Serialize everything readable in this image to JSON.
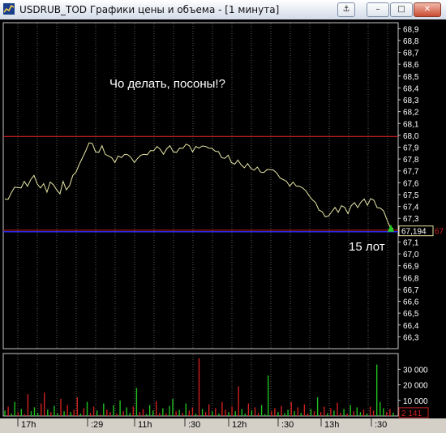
{
  "window": {
    "title": "USDRUB_TOD Графики цены и объема - [1 минута]",
    "buttons": {
      "anchor": "⚓",
      "minimize": "–",
      "maximize": "□",
      "close": "✕"
    }
  },
  "annotations": {
    "question": "Чо делать, посоны!?",
    "lots": "15 лот"
  },
  "price_axis": {
    "labels": [
      "68,9",
      "68,8",
      "68,7",
      "68,6",
      "68,5",
      "68,4",
      "68,3",
      "68,2",
      "68,1",
      "68,0",
      "67,9",
      "67,8",
      "67,7",
      "67,6",
      "67,5",
      "67,4",
      "67,3",
      "67,2",
      "67,1",
      "67,0",
      "66,9",
      "66,8",
      "66,7",
      "66,6",
      "66,5",
      "66,4",
      "66,3"
    ],
    "current_price": "67,194",
    "current_price_cut": "67"
  },
  "volume_axis": {
    "labels": [
      "30 000",
      "20 000",
      "10 000"
    ],
    "current_volume": "2 141"
  },
  "time_axis": {
    "labels": [
      "17h",
      ":29",
      "11h",
      ":30",
      "12h",
      ":30",
      "13h",
      ":30"
    ]
  },
  "colors": {
    "background": "#000000",
    "price_line": "#e8e6a8",
    "resistance": "#cc2020",
    "support": "#3030ff",
    "volume_up": "#20c020",
    "volume_down": "#d02020",
    "marker": "#20d020"
  },
  "chart_data": {
    "type": "line",
    "title": "USDRUB_TOD",
    "ylim": [
      66.2,
      68.95
    ],
    "levels": {
      "resistance": 67.99,
      "support": 67.2,
      "current": 67.194
    },
    "series": [
      {
        "values": [
          67.45,
          67.47,
          67.51,
          67.55,
          67.57,
          67.55,
          67.6,
          67.58,
          67.62,
          67.65,
          67.6,
          67.55,
          67.58,
          67.53,
          67.6,
          67.57,
          67.55,
          67.5,
          67.6,
          67.55,
          67.57,
          67.65,
          67.7,
          67.75,
          67.8,
          67.88,
          67.93,
          67.92,
          67.87,
          67.85,
          67.9,
          67.85,
          67.82,
          67.8,
          67.78,
          67.82,
          67.8,
          67.85,
          67.83,
          67.8,
          67.78,
          67.8,
          67.82,
          67.85,
          67.83,
          67.86,
          67.88,
          67.9,
          67.87,
          67.85,
          67.88,
          67.9,
          67.87,
          67.85,
          67.88,
          67.9,
          67.92,
          67.9,
          67.87,
          67.9,
          67.88,
          67.92,
          67.9,
          67.88,
          67.9,
          67.86,
          67.85,
          67.82,
          67.8,
          67.82,
          67.78,
          67.75,
          67.78,
          67.76,
          67.72,
          67.75,
          67.73,
          67.7,
          67.72,
          67.7,
          67.68,
          67.7,
          67.72,
          67.7,
          67.67,
          67.65,
          67.62,
          67.6,
          67.58,
          67.6,
          67.56,
          67.58,
          67.55,
          67.52,
          67.5,
          67.45,
          67.42,
          67.38,
          67.35,
          67.3,
          67.33,
          67.35,
          67.38,
          67.36,
          67.4,
          67.38,
          67.35,
          67.4,
          67.42,
          67.4,
          67.43,
          67.45,
          67.42,
          67.46,
          67.44,
          67.4,
          67.38,
          67.35,
          67.3,
          67.22,
          67.2
        ]
      }
    ],
    "volume": [
      3500,
      6000,
      1500,
      9000,
      2500,
      4500,
      1200,
      14000,
      3000,
      5500,
      2000,
      8000,
      15000,
      4000,
      2500,
      6500,
      1800,
      11000,
      3000,
      7000,
      2500,
      4000,
      12000,
      1500,
      5000,
      9000,
      2000,
      6000,
      3500,
      1000,
      8000,
      4000,
      2500,
      7000,
      1500,
      10000,
      3000,
      5500,
      2000,
      6000,
      18000,
      2500,
      4500,
      1200,
      7000,
      3500,
      9500,
      2000,
      5000,
      1500,
      6500,
      11000,
      3000,
      4000,
      2000,
      8000,
      3500,
      5500,
      1500,
      37000,
      4500,
      2500,
      7500,
      3000,
      5000,
      1500,
      9000,
      4000,
      2500,
      6000,
      3000,
      19000,
      4500,
      1500,
      8000,
      3500,
      5500,
      2000,
      7000,
      1200,
      26000,
      3000,
      5000,
      2500,
      6500,
      1800,
      4000,
      9000,
      3000,
      5500,
      2000,
      7500,
      1500,
      4500,
      3000,
      12000,
      2500,
      6000,
      1800,
      5000,
      3500,
      8500,
      2000,
      4500,
      1500,
      7000,
      3000,
      5500,
      2500,
      4000,
      1500,
      6000,
      3500,
      33000,
      9000,
      5000,
      2500,
      4500,
      2141
    ]
  }
}
